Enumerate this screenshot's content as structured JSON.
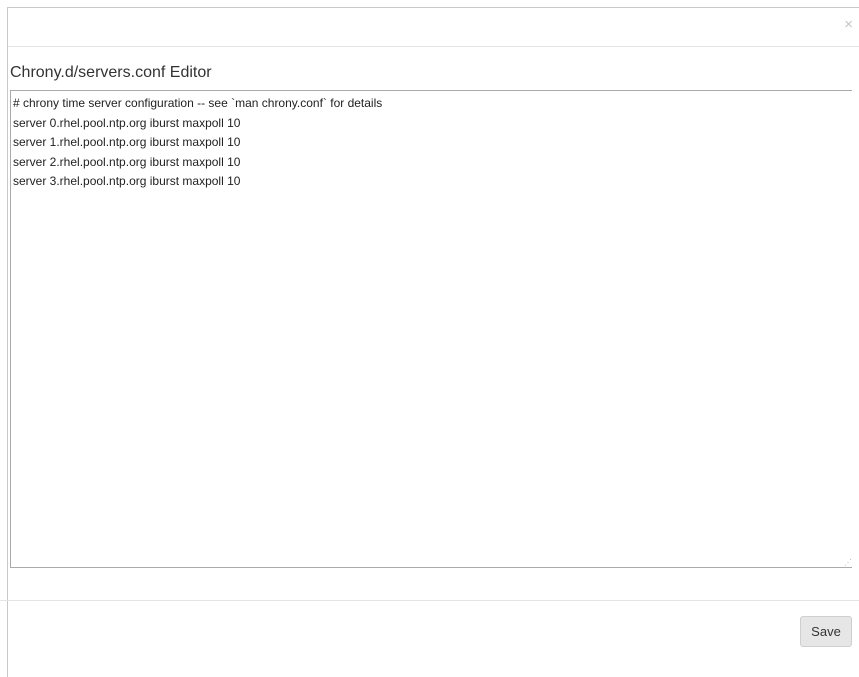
{
  "modal": {
    "close_label": "×",
    "title": "Chrony.d/servers.conf Editor",
    "editor_content": "# chrony time server configuration -- see `man chrony.conf` for details\nserver 0.rhel.pool.ntp.org iburst maxpoll 10\nserver 1.rhel.pool.ntp.org iburst maxpoll 10\nserver 2.rhel.pool.ntp.org iburst maxpoll 10\nserver 3.rhel.pool.ntp.org iburst maxpoll 10",
    "resize_handle_icon": "resize-grip",
    "save_label": "Save"
  },
  "colors": {
    "button_bg": "#e6e6e6",
    "border": "#aaaaaa",
    "text": "#333333"
  }
}
